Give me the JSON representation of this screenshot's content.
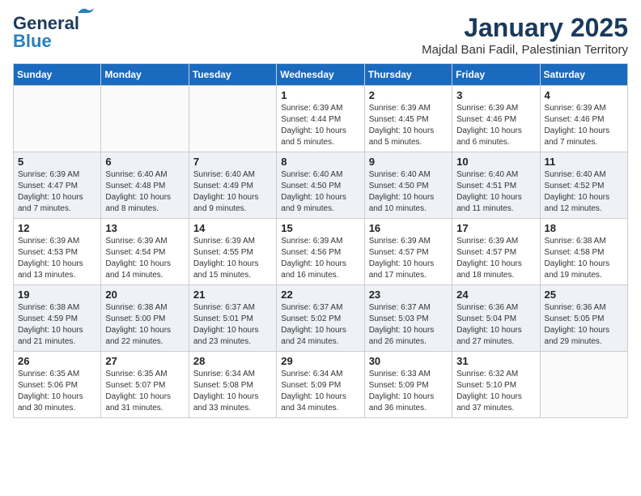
{
  "header": {
    "logo_line1": "General",
    "logo_line2": "Blue",
    "title": "January 2025",
    "subtitle": "Majdal Bani Fadil, Palestinian Territory"
  },
  "days_of_week": [
    "Sunday",
    "Monday",
    "Tuesday",
    "Wednesday",
    "Thursday",
    "Friday",
    "Saturday"
  ],
  "weeks": [
    [
      {
        "day": "",
        "info": ""
      },
      {
        "day": "",
        "info": ""
      },
      {
        "day": "",
        "info": ""
      },
      {
        "day": "1",
        "info": "Sunrise: 6:39 AM\nSunset: 4:44 PM\nDaylight: 10 hours\nand 5 minutes."
      },
      {
        "day": "2",
        "info": "Sunrise: 6:39 AM\nSunset: 4:45 PM\nDaylight: 10 hours\nand 5 minutes."
      },
      {
        "day": "3",
        "info": "Sunrise: 6:39 AM\nSunset: 4:46 PM\nDaylight: 10 hours\nand 6 minutes."
      },
      {
        "day": "4",
        "info": "Sunrise: 6:39 AM\nSunset: 4:46 PM\nDaylight: 10 hours\nand 7 minutes."
      }
    ],
    [
      {
        "day": "5",
        "info": "Sunrise: 6:39 AM\nSunset: 4:47 PM\nDaylight: 10 hours\nand 7 minutes."
      },
      {
        "day": "6",
        "info": "Sunrise: 6:40 AM\nSunset: 4:48 PM\nDaylight: 10 hours\nand 8 minutes."
      },
      {
        "day": "7",
        "info": "Sunrise: 6:40 AM\nSunset: 4:49 PM\nDaylight: 10 hours\nand 9 minutes."
      },
      {
        "day": "8",
        "info": "Sunrise: 6:40 AM\nSunset: 4:50 PM\nDaylight: 10 hours\nand 9 minutes."
      },
      {
        "day": "9",
        "info": "Sunrise: 6:40 AM\nSunset: 4:50 PM\nDaylight: 10 hours\nand 10 minutes."
      },
      {
        "day": "10",
        "info": "Sunrise: 6:40 AM\nSunset: 4:51 PM\nDaylight: 10 hours\nand 11 minutes."
      },
      {
        "day": "11",
        "info": "Sunrise: 6:40 AM\nSunset: 4:52 PM\nDaylight: 10 hours\nand 12 minutes."
      }
    ],
    [
      {
        "day": "12",
        "info": "Sunrise: 6:39 AM\nSunset: 4:53 PM\nDaylight: 10 hours\nand 13 minutes."
      },
      {
        "day": "13",
        "info": "Sunrise: 6:39 AM\nSunset: 4:54 PM\nDaylight: 10 hours\nand 14 minutes."
      },
      {
        "day": "14",
        "info": "Sunrise: 6:39 AM\nSunset: 4:55 PM\nDaylight: 10 hours\nand 15 minutes."
      },
      {
        "day": "15",
        "info": "Sunrise: 6:39 AM\nSunset: 4:56 PM\nDaylight: 10 hours\nand 16 minutes."
      },
      {
        "day": "16",
        "info": "Sunrise: 6:39 AM\nSunset: 4:57 PM\nDaylight: 10 hours\nand 17 minutes."
      },
      {
        "day": "17",
        "info": "Sunrise: 6:39 AM\nSunset: 4:57 PM\nDaylight: 10 hours\nand 18 minutes."
      },
      {
        "day": "18",
        "info": "Sunrise: 6:38 AM\nSunset: 4:58 PM\nDaylight: 10 hours\nand 19 minutes."
      }
    ],
    [
      {
        "day": "19",
        "info": "Sunrise: 6:38 AM\nSunset: 4:59 PM\nDaylight: 10 hours\nand 21 minutes."
      },
      {
        "day": "20",
        "info": "Sunrise: 6:38 AM\nSunset: 5:00 PM\nDaylight: 10 hours\nand 22 minutes."
      },
      {
        "day": "21",
        "info": "Sunrise: 6:37 AM\nSunset: 5:01 PM\nDaylight: 10 hours\nand 23 minutes."
      },
      {
        "day": "22",
        "info": "Sunrise: 6:37 AM\nSunset: 5:02 PM\nDaylight: 10 hours\nand 24 minutes."
      },
      {
        "day": "23",
        "info": "Sunrise: 6:37 AM\nSunset: 5:03 PM\nDaylight: 10 hours\nand 26 minutes."
      },
      {
        "day": "24",
        "info": "Sunrise: 6:36 AM\nSunset: 5:04 PM\nDaylight: 10 hours\nand 27 minutes."
      },
      {
        "day": "25",
        "info": "Sunrise: 6:36 AM\nSunset: 5:05 PM\nDaylight: 10 hours\nand 29 minutes."
      }
    ],
    [
      {
        "day": "26",
        "info": "Sunrise: 6:35 AM\nSunset: 5:06 PM\nDaylight: 10 hours\nand 30 minutes."
      },
      {
        "day": "27",
        "info": "Sunrise: 6:35 AM\nSunset: 5:07 PM\nDaylight: 10 hours\nand 31 minutes."
      },
      {
        "day": "28",
        "info": "Sunrise: 6:34 AM\nSunset: 5:08 PM\nDaylight: 10 hours\nand 33 minutes."
      },
      {
        "day": "29",
        "info": "Sunrise: 6:34 AM\nSunset: 5:09 PM\nDaylight: 10 hours\nand 34 minutes."
      },
      {
        "day": "30",
        "info": "Sunrise: 6:33 AM\nSunset: 5:09 PM\nDaylight: 10 hours\nand 36 minutes."
      },
      {
        "day": "31",
        "info": "Sunrise: 6:32 AM\nSunset: 5:10 PM\nDaylight: 10 hours\nand 37 minutes."
      },
      {
        "day": "",
        "info": ""
      }
    ]
  ]
}
